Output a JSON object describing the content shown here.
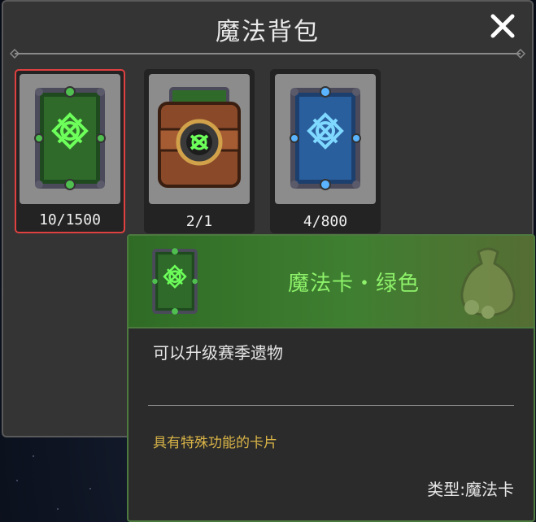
{
  "window": {
    "title": "魔法背包",
    "close_icon": "close-icon"
  },
  "slots": [
    {
      "item": "green-magic-card",
      "count": "10/1500",
      "selected": true,
      "color": "#3fae3f"
    },
    {
      "item": "leather-chest",
      "count": "2/1",
      "selected": false,
      "color": "#8a4a2a"
    },
    {
      "item": "blue-magic-card",
      "count": "4/800",
      "selected": false,
      "color": "#3a8fd8"
    }
  ],
  "tooltip": {
    "name": "魔法卡・绿色",
    "description": "可以升级赛季遗物",
    "subtitle": "具有特殊功能的卡片",
    "type_label": "类型:魔法卡",
    "name_color": "#8ef26a",
    "subtitle_color": "#d9b447"
  }
}
